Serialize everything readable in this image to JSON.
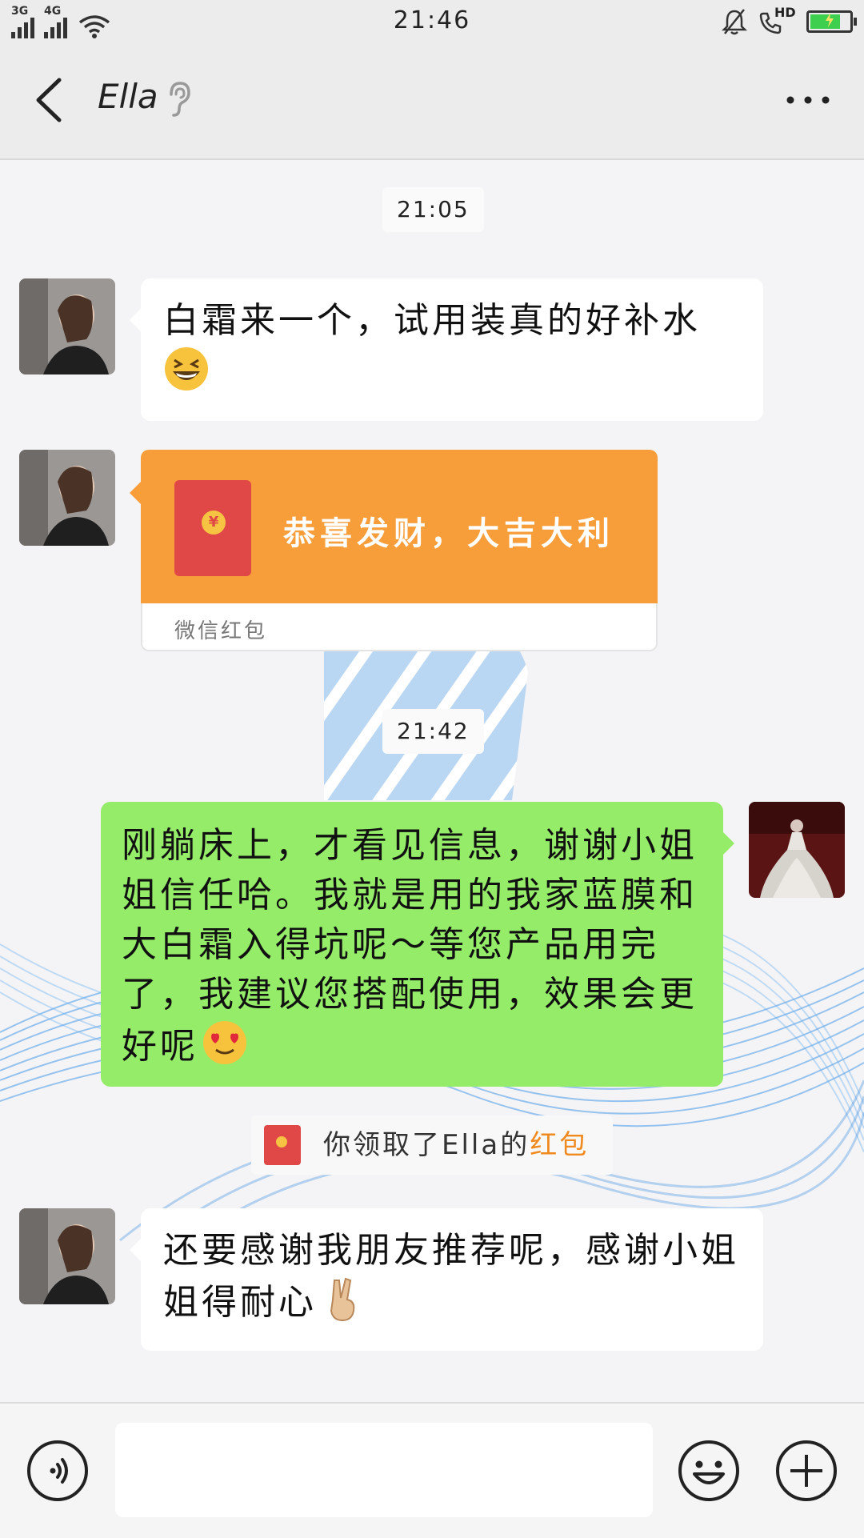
{
  "status_bar": {
    "time": "21:46",
    "network_1": "3G",
    "network_2": "4G",
    "hd_label": "HD",
    "battery_level": 0.85,
    "icons": [
      "signal-icon",
      "wifi-icon",
      "bell-muted-icon",
      "call-hd-icon",
      "battery-icon"
    ]
  },
  "header": {
    "title": "Ella",
    "icons": [
      "back-arrow-icon",
      "ear-icon",
      "more-dots-icon"
    ]
  },
  "messages": {
    "ts1": "21:05",
    "msg1": "白霜来一个，试用装真的好补水",
    "packet_title": "恭喜发财，大吉大利",
    "packet_label": "微信红包",
    "ts2": "21:42",
    "msg2": "刚躺床上，才看见信息，谢谢小姐姐信任哈。我就是用的我家蓝膜和大白霜入得坑呢～等您产品用完了，我建议您搭配使用，效果会更好呢",
    "notice_prefix": "你领取了Ella的",
    "notice_highlight": "红包",
    "msg3": "还要感谢我朋友推荐呢，感谢小姐姐得耐心"
  },
  "emojis": [
    "grinning-squint-emoji",
    "heart-eyes-emoji",
    "victory-hand-emoji"
  ],
  "input": {
    "value": "",
    "icons": [
      "voice-icon",
      "emoji-face-icon",
      "plus-icon"
    ]
  },
  "colors": {
    "right_bubble": "#95ec69",
    "packet_orange": "#f79e3a",
    "packet_red": "#e04848",
    "highlight_orange": "#f08a1e"
  }
}
